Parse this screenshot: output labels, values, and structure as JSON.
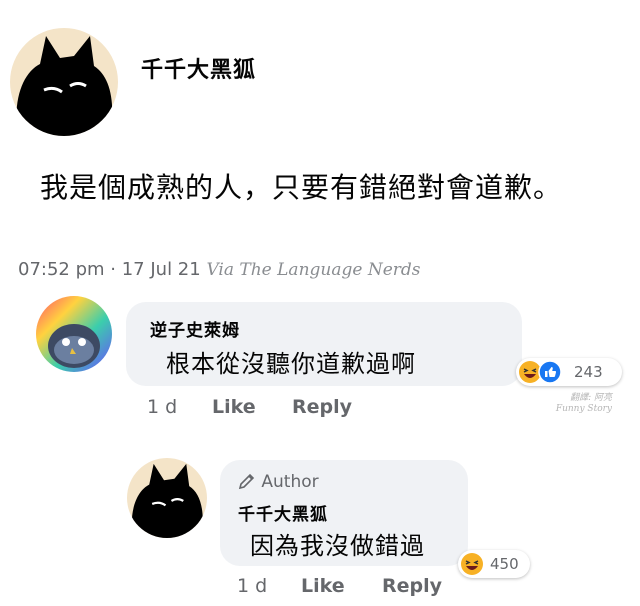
{
  "post": {
    "author": "千千大黑狐",
    "text": "我是個成熟的人，只要有錯絕對會道歉。",
    "timestamp": "07:52 pm · 17 Jul 21",
    "via": "Via The Language Nerds"
  },
  "comments": [
    {
      "author": "逆子史萊姆",
      "text": "根本從沒聽你道歉過啊",
      "age": "1 d",
      "like_label": "Like",
      "reply_label": "Reply",
      "reaction_count": "243",
      "reaction_icons": [
        "laugh-reaction-icon",
        "like-reaction-icon"
      ]
    },
    {
      "badge": "Author",
      "author": "千千大黑狐",
      "text": "因為我沒做錯過",
      "age": "1 d",
      "like_label": "Like",
      "reply_label": "Reply",
      "reaction_count": "450",
      "reaction_icons": [
        "laugh-reaction-icon"
      ]
    }
  ],
  "watermark": {
    "line1": "翻譯: 阿亮",
    "line2": "Funny Story"
  },
  "colors": {
    "bubble": "#f0f2f5",
    "meta_text": "#65676b",
    "like_blue": "#1877f2",
    "laugh_yellow": "#f7b125"
  }
}
